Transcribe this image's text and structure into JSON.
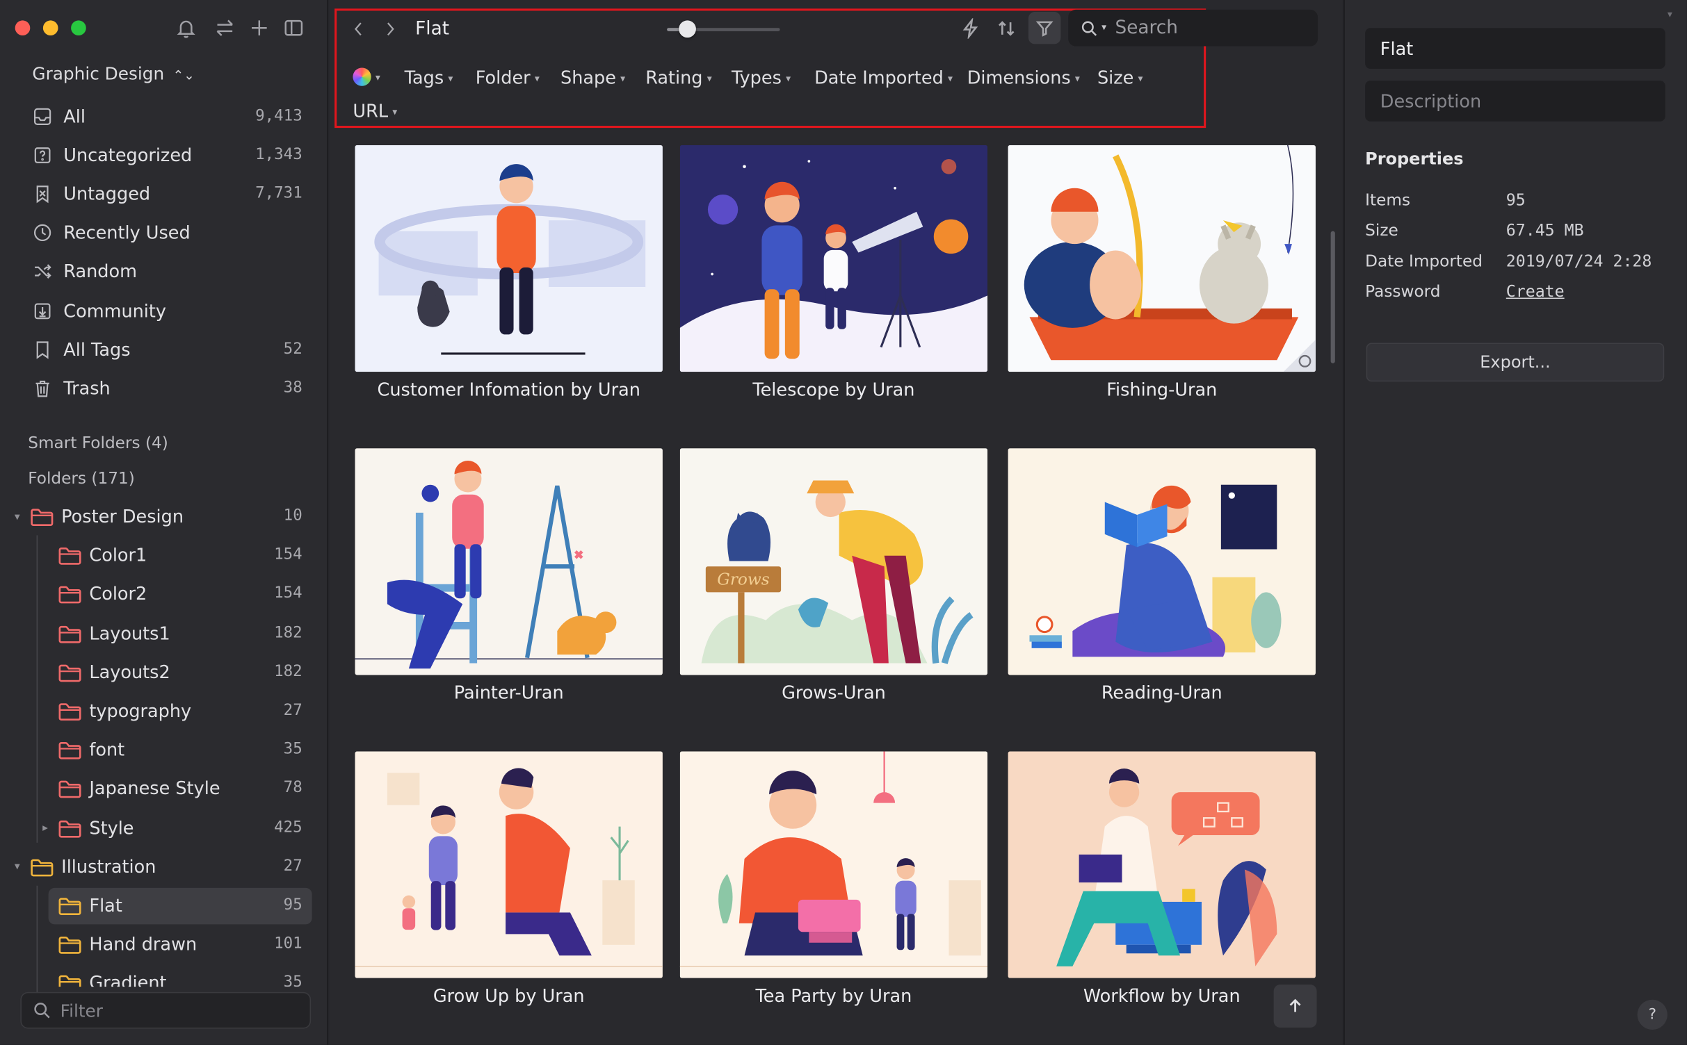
{
  "sidebar": {
    "library_name": "Graphic Design",
    "library_caret": "⌃",
    "smart_folders": [
      {
        "label": "All",
        "count": "9,413",
        "icon": "inbox-icon"
      },
      {
        "label": "Uncategorized",
        "count": "1,343",
        "icon": "question-box-icon"
      },
      {
        "label": "Untagged",
        "count": "7,731",
        "icon": "untagged-icon"
      },
      {
        "label": "Recently Used",
        "count": "",
        "icon": "clock-icon"
      },
      {
        "label": "Random",
        "count": "",
        "icon": "shuffle-icon"
      },
      {
        "label": "Community",
        "count": "",
        "icon": "download-box-icon"
      },
      {
        "label": "All Tags",
        "count": "52",
        "icon": "bookmark-icon"
      },
      {
        "label": "Trash",
        "count": "38",
        "icon": "trash-icon"
      }
    ],
    "smart_folders_header": "Smart Folders (4)",
    "folders_header": "Folders (171)",
    "folders": [
      {
        "label": "Poster Design",
        "count": "10",
        "color": "#f06a6a"
      },
      {
        "label": "Color1",
        "count": "154",
        "color": "#f06a6a"
      },
      {
        "label": "Color2",
        "count": "154",
        "color": "#f06a6a"
      },
      {
        "label": "Layouts1",
        "count": "182",
        "color": "#f06a6a"
      },
      {
        "label": "Layouts2",
        "count": "182",
        "color": "#f06a6a"
      },
      {
        "label": "typography",
        "count": "27",
        "color": "#f06a6a"
      },
      {
        "label": "font",
        "count": "35",
        "color": "#f06a6a"
      },
      {
        "label": "Japanese Style",
        "count": "78",
        "color": "#f06a6a"
      },
      {
        "label": "Style",
        "count": "425",
        "color": "#f06a6a"
      },
      {
        "label": "Illustration",
        "count": "27",
        "color": "#f0b43c"
      },
      {
        "label": "Flat",
        "count": "95",
        "color": "#f0b43c"
      },
      {
        "label": "Hand drawn",
        "count": "101",
        "color": "#f0b43c"
      },
      {
        "label": "Gradient",
        "count": "35",
        "color": "#f0b43c"
      }
    ],
    "filter_placeholder": "Filter"
  },
  "toolbar": {
    "breadcrumb": "Flat",
    "thumbnail_size_fraction": 0.18,
    "search_placeholder": "Search",
    "filters": [
      "Tags",
      "Folder",
      "Shape",
      "Rating",
      "Types",
      "Date Imported",
      "Dimensions",
      "Size",
      "URL"
    ]
  },
  "grid": {
    "items": [
      {
        "title": "Customer Infomation by Uran"
      },
      {
        "title": "Telescope by Uran"
      },
      {
        "title": "Fishing-Uran"
      },
      {
        "title": "Painter-Uran"
      },
      {
        "title": "Grows-Uran"
      },
      {
        "title": "Reading-Uran"
      },
      {
        "title": "Grow Up by Uran"
      },
      {
        "title": "Tea Party by Uran"
      },
      {
        "title": "Workflow by Uran"
      }
    ],
    "grows_sign": "Grows"
  },
  "inspector": {
    "name_value": "Flat",
    "description_placeholder": "Description",
    "properties_header": "Properties",
    "properties": [
      {
        "key": "Items",
        "value": "95"
      },
      {
        "key": "Size",
        "value": "67.45 MB"
      },
      {
        "key": "Date Imported",
        "value": "2019/07/24 2:28"
      },
      {
        "key": "Password",
        "value": "Create"
      }
    ],
    "export_label": "Export...",
    "help_label": "?"
  },
  "colors": {
    "highlight_border": "#e0161d",
    "folder_red": "#f06a6a",
    "folder_yellow": "#f0b43c",
    "selection": "#3e3e43"
  }
}
